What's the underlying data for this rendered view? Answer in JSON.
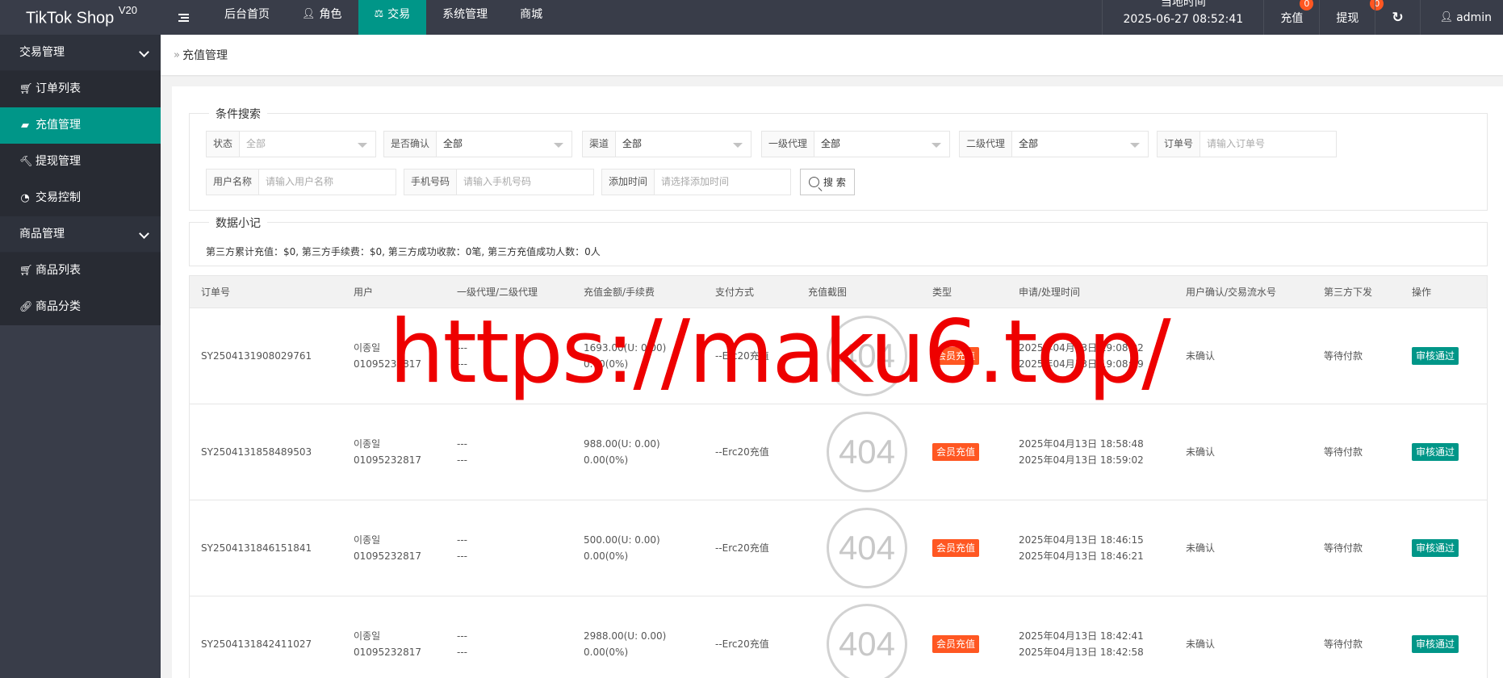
{
  "app": {
    "title": "TikTok Shop",
    "version": "V20"
  },
  "nav": [
    {
      "label": "后台首页",
      "icon": "",
      "active": false
    },
    {
      "label": "角色",
      "icon": "user-icon",
      "active": false
    },
    {
      "label": "交易",
      "icon": "scale-icon",
      "active": true
    },
    {
      "label": "系统管理",
      "icon": "",
      "active": false
    },
    {
      "label": "商城",
      "icon": "",
      "active": false
    }
  ],
  "header_right": {
    "time_label": "当地时间",
    "time_value": "2025-06-27 08:52:41",
    "recharge_label": "充值",
    "recharge_count": "0",
    "withdraw_label": "提现",
    "withdraw_count": "0",
    "refresh_icon": "refresh-icon",
    "user": "admin"
  },
  "sidebar": {
    "group1": "交易管理",
    "group1_items": [
      {
        "label": "订单列表",
        "icon": "cart-icon"
      },
      {
        "label": "充值管理",
        "icon": "chat-icon",
        "active": true
      },
      {
        "label": "提现管理",
        "icon": "gavel-icon"
      },
      {
        "label": "交易控制",
        "icon": "dashboard-icon"
      }
    ],
    "group2": "商品管理",
    "group2_items": [
      {
        "label": "商品列表",
        "icon": "cart-icon"
      },
      {
        "label": "商品分类",
        "icon": "link-icon"
      }
    ]
  },
  "breadcrumb": "充值管理",
  "search": {
    "legend": "条件搜索",
    "status_label": "状态",
    "status_value": "全部",
    "confirm_label": "是否确认",
    "confirm_value": "全部",
    "channel_label": "渠道",
    "channel_value": "全部",
    "agent1_label": "一级代理",
    "agent1_value": "全部",
    "agent2_label": "二级代理",
    "agent2_value": "全部",
    "order_label": "订单号",
    "order_placeholder": "请输入订单号",
    "username_label": "用户名称",
    "username_placeholder": "请输入用户名称",
    "phone_label": "手机号码",
    "phone_placeholder": "请输入手机号码",
    "time_label": "添加时间",
    "time_placeholder": "请选择添加时间",
    "button": "搜 索"
  },
  "stats": {
    "legend": "数据小记",
    "text": "第三方累计充值：$0,   第三方手续费：$0,   第三方成功收款：0笔,   第三方充值成功人数：0人"
  },
  "table": {
    "headers": [
      "订单号",
      "用户",
      "一级代理/二级代理",
      "充值金额/手续费",
      "支付方式",
      "充值截图",
      "类型",
      "申请/处理时间",
      "用户确认/交易流水号",
      "第三方下发",
      "操作"
    ],
    "rows": [
      {
        "order": "SY2504131908029761",
        "user_name": "이종일",
        "user_phone": "01095232817",
        "agent1": "---",
        "agent2": "---",
        "amount": "1693.00(U: 0.00)",
        "fee": "0.00(0%)",
        "method": "--Erc20充值",
        "img": "404",
        "type": "会员充值",
        "apply": "2025年04月13日 19:08:02",
        "process": "2025年04月13日 19:08:19",
        "confirm": "未确认",
        "third": "等待付款",
        "action": "审核通过"
      },
      {
        "order": "SY2504131858489503",
        "user_name": "이종일",
        "user_phone": "01095232817",
        "agent1": "---",
        "agent2": "---",
        "amount": "988.00(U: 0.00)",
        "fee": "0.00(0%)",
        "method": "--Erc20充值",
        "img": "404",
        "type": "会员充值",
        "apply": "2025年04月13日 18:58:48",
        "process": "2025年04月13日 18:59:02",
        "confirm": "未确认",
        "third": "等待付款",
        "action": "审核通过"
      },
      {
        "order": "SY2504131846151841",
        "user_name": "이종일",
        "user_phone": "01095232817",
        "agent1": "---",
        "agent2": "---",
        "amount": "500.00(U: 0.00)",
        "fee": "0.00(0%)",
        "method": "--Erc20充值",
        "img": "404",
        "type": "会员充值",
        "apply": "2025年04月13日 18:46:15",
        "process": "2025年04月13日 18:46:21",
        "confirm": "未确认",
        "third": "等待付款",
        "action": "审核通过"
      },
      {
        "order": "SY2504131842411027",
        "user_name": "이종일",
        "user_phone": "01095232817",
        "agent1": "---",
        "agent2": "---",
        "amount": "2988.00(U: 0.00)",
        "fee": "0.00(0%)",
        "method": "--Erc20充值",
        "img": "404",
        "type": "会员充值",
        "apply": "2025年04月13日 18:42:41",
        "process": "2025年04月13日 18:42:58",
        "confirm": "未确认",
        "third": "等待付款",
        "action": "审核通过"
      }
    ]
  },
  "watermark": "https://maku6.top/",
  "colors": {
    "header": "#393d49",
    "accent": "#009688",
    "tag": "#ff5722"
  }
}
